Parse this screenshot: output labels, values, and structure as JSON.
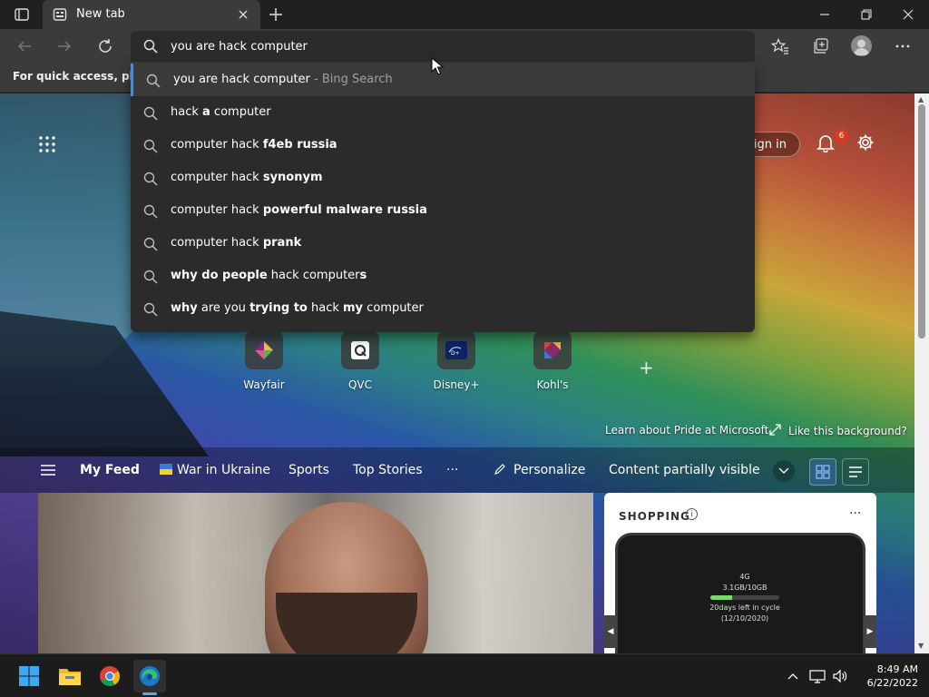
{
  "browser": {
    "tab_title": "New tab",
    "address_value": "you are hack computer",
    "favorites_hint": "For quick access, place y"
  },
  "suggestions": [
    {
      "parts": [
        {
          "t": "you are hack computer",
          "b": false
        }
      ],
      "hint": " - Bing Search"
    },
    {
      "parts": [
        {
          "t": "hack ",
          "b": false
        },
        {
          "t": "a",
          "b": true
        },
        {
          "t": " computer",
          "b": false
        }
      ],
      "hint": ""
    },
    {
      "parts": [
        {
          "t": "computer hack ",
          "b": false
        },
        {
          "t": "f4eb russia",
          "b": true
        }
      ],
      "hint": ""
    },
    {
      "parts": [
        {
          "t": "computer hack ",
          "b": false
        },
        {
          "t": "synonym",
          "b": true
        }
      ],
      "hint": ""
    },
    {
      "parts": [
        {
          "t": "computer hack ",
          "b": false
        },
        {
          "t": "powerful malware russia",
          "b": true
        }
      ],
      "hint": ""
    },
    {
      "parts": [
        {
          "t": "computer hack ",
          "b": false
        },
        {
          "t": "prank",
          "b": true
        }
      ],
      "hint": ""
    },
    {
      "parts": [
        {
          "t": "why do people",
          "b": true
        },
        {
          "t": " hack computer",
          "b": false
        },
        {
          "t": "s",
          "b": true
        }
      ],
      "hint": ""
    },
    {
      "parts": [
        {
          "t": "why",
          "b": true
        },
        {
          "t": " are you ",
          "b": false
        },
        {
          "t": "trying to",
          "b": true
        },
        {
          "t": " hack ",
          "b": false
        },
        {
          "t": "my",
          "b": true
        },
        {
          "t": " computer",
          "b": false
        }
      ],
      "hint": ""
    }
  ],
  "ntp": {
    "signin_label": "Sign in",
    "notification_count": "6",
    "tiles": [
      {
        "label": "Wayfair",
        "icon": "wayfair-icon"
      },
      {
        "label": "QVC",
        "icon": "qvc-icon"
      },
      {
        "label": "Disney+",
        "icon": "disney-plus-icon"
      },
      {
        "label": "Kohl's",
        "icon": "kohls-icon"
      }
    ],
    "pride_link": "Learn about Pride at Microsoft",
    "background_link": "Like this background?"
  },
  "feed": {
    "my_feed": "My Feed",
    "war_in_ukraine": "War in Ukraine",
    "sports": "Sports",
    "top_stories": "Top Stories",
    "more": "···",
    "personalize": "Personalize",
    "content_visibility": "Content partially visible"
  },
  "shopping": {
    "title": "SHOPPING",
    "info": "i",
    "more": "···",
    "device_status": "4G",
    "device_usage": "3.1GB/10GB",
    "device_usage_fraction": 0.31,
    "device_days": "20days left in cycle",
    "device_date": "(12/10/2020)"
  },
  "taskbar": {
    "time": "8:49 AM",
    "date": "6/22/2022"
  },
  "colors": {
    "accent": "#4f8cc9",
    "chrome_bg": "#202020",
    "toolbar_bg": "#3b3b3b",
    "dropdown_bg": "#2b2b2b"
  }
}
